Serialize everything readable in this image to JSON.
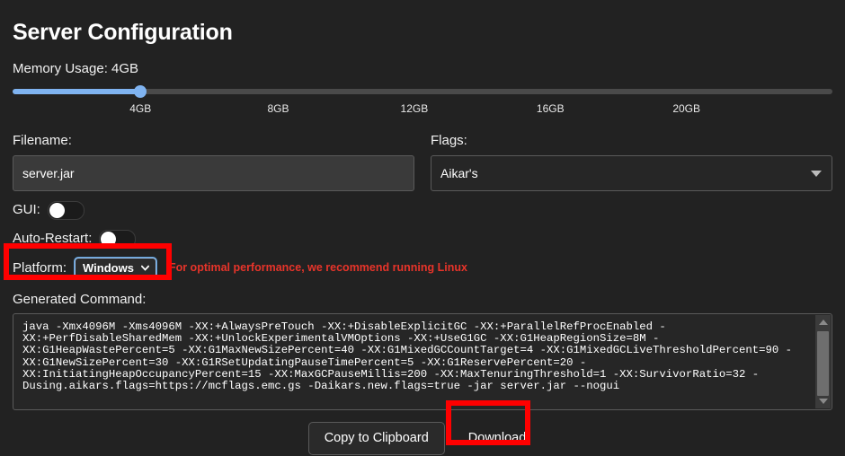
{
  "header": {
    "title": "Server Configuration"
  },
  "memory": {
    "label": "Memory Usage: 4GB",
    "value_gb": 4,
    "min_gb": 1,
    "max_gb": 24,
    "fill_percent": 15.6,
    "ticks": [
      {
        "label": "4GB",
        "pos_percent": 15.6
      },
      {
        "label": "8GB",
        "pos_percent": 32.4
      },
      {
        "label": "12GB",
        "pos_percent": 49.0
      },
      {
        "label": "16GB",
        "pos_percent": 65.6
      },
      {
        "label": "20GB",
        "pos_percent": 82.2
      }
    ]
  },
  "filename": {
    "label": "Filename:",
    "value": "server.jar",
    "placeholder": "server.jar"
  },
  "flags": {
    "label": "Flags:",
    "selected": "Aikar's",
    "caret_icon": "triangle-down-icon"
  },
  "gui": {
    "label": "GUI:",
    "state": "off"
  },
  "auto_restart": {
    "label": "Auto-Restart:",
    "state": "off"
  },
  "platform": {
    "label": "Platform:",
    "selected": "Windows",
    "chevron_icon": "chevron-down-icon",
    "warning": "For optimal performance, we recommend running Linux",
    "warning_color": "#e8342a"
  },
  "generated_command": {
    "label": "Generated Command:",
    "text": "java -Xmx4096M -Xms4096M -XX:+AlwaysPreTouch -XX:+DisableExplicitGC -XX:+ParallelRefProcEnabled -XX:+PerfDisableSharedMem -XX:+UnlockExperimentalVMOptions -XX:+UseG1GC -XX:G1HeapRegionSize=8M -XX:G1HeapWastePercent=5 -XX:G1MaxNewSizePercent=40 -XX:G1MixedGCCountTarget=4 -XX:G1MixedGCLiveThresholdPercent=90 -XX:G1NewSizePercent=30 -XX:G1RSetUpdatingPauseTimePercent=5 -XX:G1ReservePercent=20 -XX:InitiatingHeapOccupancyPercent=15 -XX:MaxGCPauseMillis=200 -XX:MaxTenuringThreshold=1 -XX:SurvivorRatio=32 -Dusing.aikars.flags=https://mcflags.emc.gs -Daikars.new.flags=true -jar server.jar --nogui",
    "scroll_up_icon": "arrow-up-icon",
    "scroll_down_icon": "arrow-down-icon"
  },
  "actions": {
    "copy_label": "Copy to Clipboard",
    "download_label": "Download"
  },
  "annotations": {
    "color": "#ff0000",
    "boxes": [
      {
        "name": "platform-highlight"
      },
      {
        "name": "download-highlight"
      }
    ]
  }
}
